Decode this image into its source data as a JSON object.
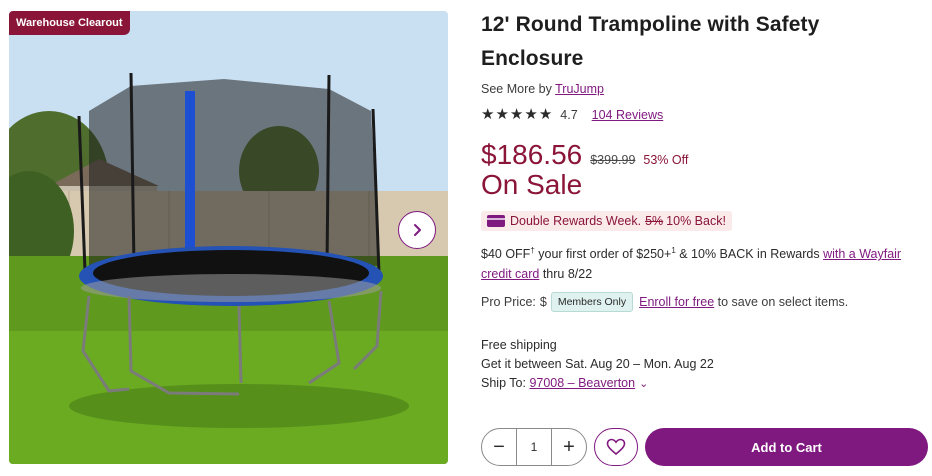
{
  "image": {
    "badge": "Warehouse Clearout"
  },
  "product": {
    "title": "12' Round Trampoline with Safety Enclosure",
    "see_more_prefix": "See More by",
    "brand": "TruJump",
    "rating": "4.7",
    "star_count": 5,
    "reviews_label": "104 Reviews",
    "price": "$186.56",
    "old_price": "$399.99",
    "percent_off": "53% Off",
    "sale_label": "On Sale"
  },
  "rewards": {
    "label": "Double Rewards Week.",
    "old_pct": "5%",
    "new_pct": "10% Back!"
  },
  "offer": {
    "amount": "$40 OFF",
    "sup1": "†",
    "text1": " your first order of $250+",
    "sup2": "1",
    "text2": " & 10% BACK in Rewards ",
    "link": "with a Wayfair credit card",
    "text3": " thru 8/22"
  },
  "pro": {
    "label": "Pro Price:",
    "dollar": "$",
    "members": "Members Only",
    "enroll_link": "Enroll for free",
    "suffix": " to save on select items."
  },
  "shipping": {
    "free": "Free shipping",
    "window": "Get it between Sat. Aug 20 – Mon. Aug 22",
    "ship_to_label": "Ship To:",
    "location": "97008 – Beaverton"
  },
  "purchase": {
    "qty": "1",
    "minus": "−",
    "plus": "+",
    "add_to_cart": "Add to Cart"
  },
  "colors": {
    "brand_purple": "#7f187f",
    "sale_red": "#8a1538",
    "members_teal": "#dff2ef"
  }
}
